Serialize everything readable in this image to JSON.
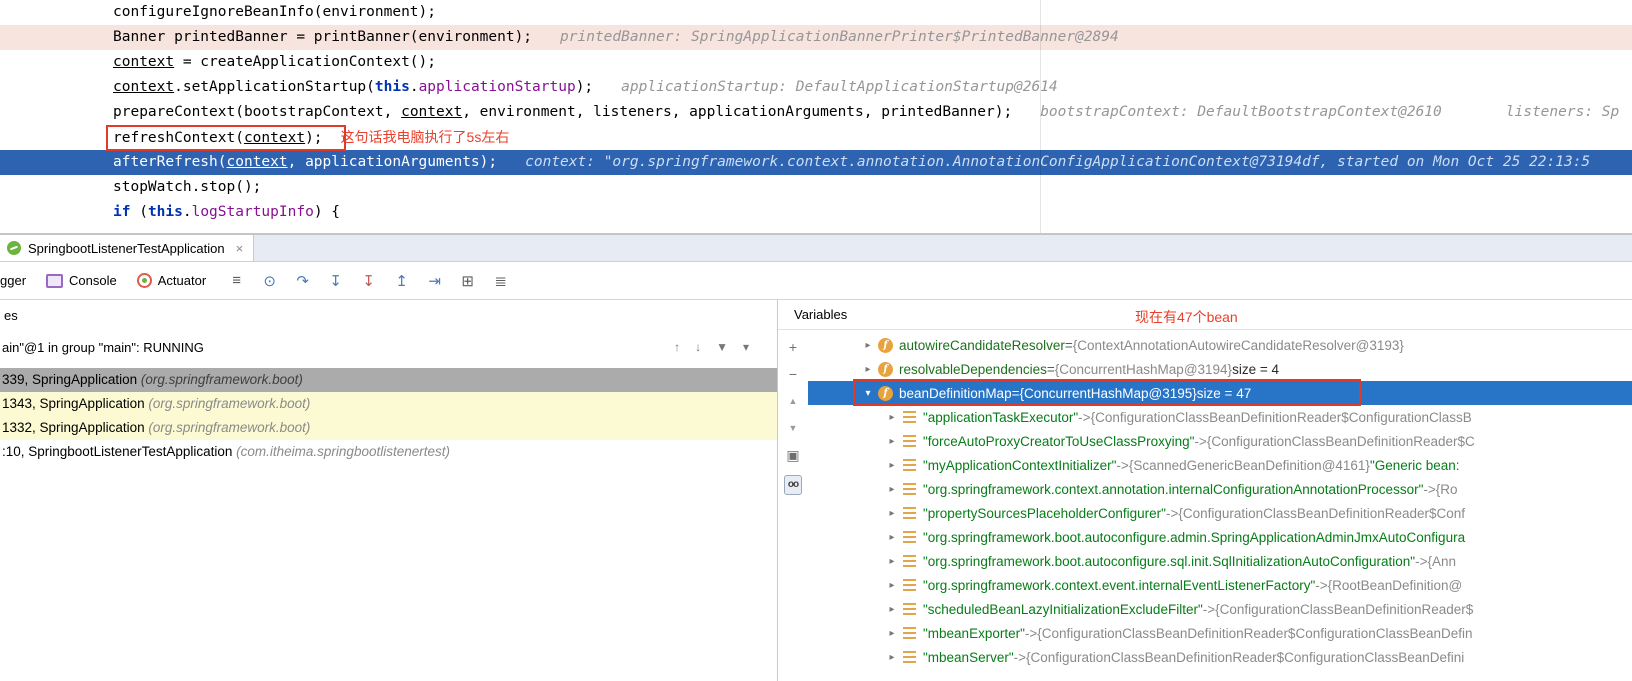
{
  "colors": {
    "execution_line_bg": "#2D63B0",
    "breakpoint_line_bg": "#F8E4DF",
    "selection_bg": "#2874C6",
    "library_frame_bg": "#FBFAD2",
    "annotation_red": "#E8402C",
    "keyword_blue": "#0033B3",
    "field_purple": "#871094",
    "string_green": "#067D17"
  },
  "editor": {
    "lines": [
      {
        "segments": [
          {
            "t": "configureIgnoreBeanInfo(environment);"
          }
        ]
      },
      {
        "bg": "pink",
        "segments": [
          {
            "t": "Banner printedBanner = printBanner(environment);"
          },
          {
            "t": "printedBanner: SpringApplicationBannerPrinter$PrintedBanner@2894",
            "c": "hint"
          }
        ]
      },
      {
        "segments": [
          {
            "t": "context",
            "c": "varul"
          },
          {
            "t": " = createApplicationContext();"
          }
        ]
      },
      {
        "segments": [
          {
            "t": "context",
            "c": "varul"
          },
          {
            "t": ".setApplicationStartup("
          },
          {
            "t": "this",
            "c": "kw"
          },
          {
            "t": "."
          },
          {
            "t": "applicationStartup",
            "c": "field"
          },
          {
            "t": ");"
          },
          {
            "t": "applicationStartup: DefaultApplicationStartup@2614",
            "c": "hint"
          }
        ]
      },
      {
        "segments": [
          {
            "t": "prepareContext(bootstrapContext, "
          },
          {
            "t": "context",
            "c": "varul"
          },
          {
            "t": ", environment, listeners, applicationArguments, printedBanner);"
          },
          {
            "t": "bootstrapContext: DefaultBootstrapContext@2610",
            "c": "hint"
          },
          {
            "t": "listeners: Sp",
            "c": "hint2"
          }
        ]
      },
      {
        "segments": [
          {
            "t": "refreshContext("
          },
          {
            "t": "context",
            "c": "varul"
          },
          {
            "t": ");"
          },
          {
            "t": "这句话我电脑执行了5s左右",
            "c": "red"
          }
        ]
      },
      {
        "bg": "exec",
        "segments": [
          {
            "t": "afterRefresh("
          },
          {
            "t": "context",
            "c": "varul"
          },
          {
            "t": ", applicationArguments);"
          },
          {
            "t": "context: \"org.springframework.context.annotation.AnnotationConfigApplicationContext@73194df, started on Mon Oct 25 22:13:5",
            "c": "hint"
          }
        ]
      },
      {
        "segments": [
          {
            "t": "stopWatch.stop();"
          }
        ]
      },
      {
        "segments": [
          {
            "t": "if",
            "c": "kw"
          },
          {
            "t": " ("
          },
          {
            "t": "this",
            "c": "kw"
          },
          {
            "t": "."
          },
          {
            "t": "logStartupInfo",
            "c": "field"
          },
          {
            "t": ") {"
          }
        ]
      }
    ]
  },
  "tabbar": {
    "tab_title": "SpringbootListenerTestApplication",
    "close_glyph": "×"
  },
  "toolbar": {
    "tabs": [
      {
        "label": "gger",
        "icon": null
      },
      {
        "label": "Console",
        "icon": "console-icon"
      },
      {
        "label": "Actuator",
        "icon": "actuator-icon"
      }
    ],
    "icons": [
      {
        "name": "hamburger-menu-icon",
        "glyph": "≡",
        "tone": "dark"
      },
      {
        "name": "show-execution-point-icon",
        "glyph": "⊙",
        "tone": "blue"
      },
      {
        "name": "step-over-icon",
        "glyph": "↷",
        "tone": "blue"
      },
      {
        "name": "step-into-icon",
        "glyph": "↧",
        "tone": "blue"
      },
      {
        "name": "force-step-into-icon",
        "glyph": "↧",
        "tone": "red"
      },
      {
        "name": "step-out-icon",
        "glyph": "↥",
        "tone": "blue"
      },
      {
        "name": "run-to-cursor-icon",
        "glyph": "⇥",
        "tone": "blue"
      },
      {
        "name": "view-breakpoints-icon",
        "glyph": "⊞",
        "tone": "dark"
      },
      {
        "name": "settings-icon",
        "glyph": "≣",
        "tone": "dark"
      }
    ]
  },
  "frames": {
    "header_label": "es",
    "thread": "ain\"@1 in group \"main\": RUNNING",
    "icons": [
      {
        "name": "frame-up-icon",
        "glyph": "↑"
      },
      {
        "name": "frame-down-icon",
        "glyph": "↓"
      },
      {
        "name": "filter-icon",
        "glyph": "▼"
      },
      {
        "name": "dropdown-chevron-icon",
        "glyph": "▾"
      }
    ],
    "rows": [
      {
        "location": "339, SpringApplication ",
        "package": "(org.springframework.boot)",
        "state": "selected"
      },
      {
        "location": "1343, SpringApplication ",
        "package": "(org.springframework.boot)",
        "state": "library"
      },
      {
        "location": "1332, SpringApplication ",
        "package": "(org.springframework.boot)",
        "state": "library"
      },
      {
        "location": ":10, SpringbootListenerTestApplication ",
        "package": "(com.itheima.springbootlistenertest)",
        "state": "normal"
      }
    ]
  },
  "side_toolbar": [
    {
      "name": "add-watch-icon",
      "glyph": "+"
    },
    {
      "name": "remove-watch-icon",
      "glyph": "−"
    },
    {
      "name": "scroll-up-icon",
      "glyph": "▲",
      "small": true
    },
    {
      "name": "scroll-down-icon",
      "glyph": "▼",
      "small": true
    },
    {
      "name": "copy-value-icon",
      "glyph": "▣"
    },
    {
      "name": "watches-icon",
      "glyph": "oo",
      "boxed": true
    }
  ],
  "variables": {
    "title": "Variables",
    "annotation": "现在有47个bean",
    "rows": [
      {
        "level": 0,
        "chevron": "collapsed",
        "icon": "field",
        "name": "autowireCandidateResolver",
        "sep": " = ",
        "value": "{ContextAnnotationAutowireCandidateResolver@3193}"
      },
      {
        "level": 0,
        "chevron": "collapsed",
        "icon": "field",
        "name": "resolvableDependencies",
        "sep": " = ",
        "value": "{ConcurrentHashMap@3194}",
        "extra": "  size = 4"
      },
      {
        "level": 0,
        "chevron": "expanded",
        "icon": "field",
        "name": "beanDefinitionMap",
        "sep": " = ",
        "value": "{ConcurrentHashMap@3195}",
        "extra": "  size = 47",
        "selected": true
      },
      {
        "level": 1,
        "chevron": "collapsed",
        "icon": "entry",
        "key": "\"applicationTaskExecutor\"",
        "arrow": " -> ",
        "value": "{ConfigurationClassBeanDefinitionReader$ConfigurationClassB"
      },
      {
        "level": 1,
        "chevron": "collapsed",
        "icon": "entry",
        "key": "\"forceAutoProxyCreatorToUseClassProxying\"",
        "arrow": " -> ",
        "value": "{ConfigurationClassBeanDefinitionReader$C"
      },
      {
        "level": 1,
        "chevron": "collapsed",
        "icon": "entry",
        "key": "\"myApplicationContextInitializer\"",
        "arrow": " -> ",
        "value": "{ScannedGenericBeanDefinition@4161} ",
        "tail": "\"Generic bean: "
      },
      {
        "level": 1,
        "chevron": "collapsed",
        "icon": "entry",
        "key": "\"org.springframework.context.annotation.internalConfigurationAnnotationProcessor\"",
        "arrow": " -> ",
        "value": "{Ro"
      },
      {
        "level": 1,
        "chevron": "collapsed",
        "icon": "entry",
        "key": "\"propertySourcesPlaceholderConfigurer\"",
        "arrow": " -> ",
        "value": "{ConfigurationClassBeanDefinitionReader$Conf"
      },
      {
        "level": 1,
        "chevron": "collapsed",
        "icon": "entry",
        "key": "\"org.springframework.boot.autoconfigure.admin.SpringApplicationAdminJmxAutoConfigura",
        "arrow": "",
        "value": ""
      },
      {
        "level": 1,
        "chevron": "collapsed",
        "icon": "entry",
        "key": "\"org.springframework.boot.autoconfigure.sql.init.SqlInitializationAutoConfiguration\"",
        "arrow": " -> ",
        "value": "{Ann"
      },
      {
        "level": 1,
        "chevron": "collapsed",
        "icon": "entry",
        "key": "\"org.springframework.context.event.internalEventListenerFactory\"",
        "arrow": " -> ",
        "value": "{RootBeanDefinition@"
      },
      {
        "level": 1,
        "chevron": "collapsed",
        "icon": "entry",
        "key": "\"scheduledBeanLazyInitializationExcludeFilter\"",
        "arrow": " -> ",
        "value": "{ConfigurationClassBeanDefinitionReader$"
      },
      {
        "level": 1,
        "chevron": "collapsed",
        "icon": "entry",
        "key": "\"mbeanExporter\"",
        "arrow": " -> ",
        "value": "{ConfigurationClassBeanDefinitionReader$ConfigurationClassBeanDefin"
      },
      {
        "level": 1,
        "chevron": "collapsed",
        "icon": "entry",
        "key": "\"mbeanServer\"",
        "arrow": " -> ",
        "value": "{ConfigurationClassBeanDefinitionReader$ConfigurationClassBeanDefini"
      }
    ]
  }
}
